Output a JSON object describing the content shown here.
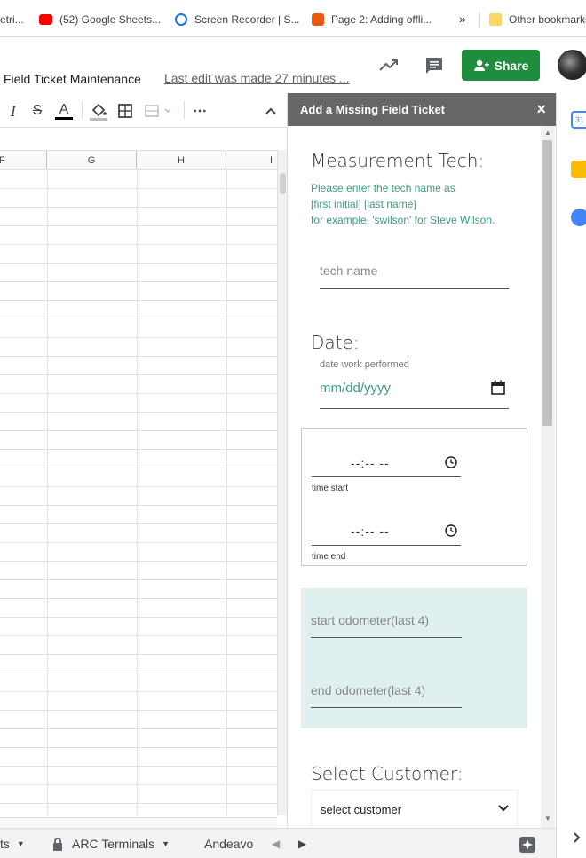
{
  "bookmarks": {
    "items": [
      {
        "label": "etri..."
      },
      {
        "label": "(52) Google Sheets..."
      },
      {
        "label": "Screen Recorder | S..."
      },
      {
        "label": "Page 2: Adding offli..."
      }
    ],
    "more": "»",
    "other": "Other bookmarks"
  },
  "doc": {
    "title": "Field Ticket Maintenance",
    "last_edit": "Last edit was made 27 minutes ...",
    "share_label": "Share"
  },
  "toolbar": {
    "italic": "I",
    "strike": "S",
    "text_color": "A",
    "more": "⋯",
    "collapse": "^"
  },
  "grid": {
    "columns": [
      "F",
      "G",
      "H",
      "I"
    ]
  },
  "sheet_tabs": [
    {
      "label": "ts"
    },
    {
      "label": "ARC Terminals"
    },
    {
      "label": "Andeavo"
    }
  ],
  "sidebar": {
    "title": "Add a Missing Field Ticket",
    "close": "×",
    "tech": {
      "heading": "Measurement Tech:",
      "help_line1": "Please enter the tech name as",
      "help_line2": "[first initial] [last name]",
      "help_line3": "for example, 'swilson' for Steve Wilson.",
      "placeholder": "tech name"
    },
    "date": {
      "heading": "Date:",
      "label": "date work performed",
      "value": "mm/dd/yyyy"
    },
    "time": {
      "start_value": "--:-- --",
      "start_label": "time start",
      "end_value": "--:-- --",
      "end_label": "time end"
    },
    "odometer": {
      "start_placeholder": "start odometer(last 4)",
      "end_placeholder": "end odometer(last 4)"
    },
    "customer": {
      "heading": "Select Customer:",
      "selected": "select customer"
    }
  },
  "colors": {
    "share_green": "#1e8e3e",
    "accent_teal": "#3d9a8a",
    "odometer_bg": "#dff0ef",
    "sidebar_header": "#666666"
  }
}
